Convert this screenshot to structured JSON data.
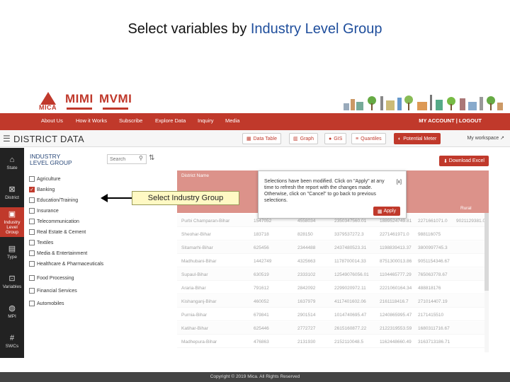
{
  "slide": {
    "title_prefix": "Select variables by ",
    "title_highlight": "Industry Level Group"
  },
  "brand": {
    "logos": [
      "MICA",
      "MIMI",
      "MVMI"
    ],
    "accent": "#c0392b"
  },
  "nav": {
    "items": [
      "About Us",
      "How it Works",
      "Subscribe",
      "Explore Data",
      "Inquiry",
      "Media"
    ],
    "account": "MY ACCOUNT | LOGOUT"
  },
  "header": {
    "title": "DISTRICT DATA",
    "tools": [
      "Data Table",
      "Graph",
      "GIS",
      "Quantiles",
      "Potential Meter"
    ],
    "workspace": "My workspace"
  },
  "rail": [
    {
      "icon": "state-icon",
      "label": "State"
    },
    {
      "icon": "district-icon",
      "label": "District"
    },
    {
      "icon": "industry-icon",
      "label": "Industry Level Group"
    },
    {
      "icon": "type-icon",
      "label": "Type"
    },
    {
      "icon": "variables-icon",
      "label": "Variables"
    },
    {
      "icon": "mpi-icon",
      "label": "MPI"
    },
    {
      "icon": "swcs-icon",
      "label": "SWCs"
    }
  ],
  "panel": {
    "heading_line1": "INDUSTRY",
    "heading_line2": "LEVEL GROUP",
    "search_placeholder": "Search",
    "options": [
      {
        "label": "Agriculture",
        "checked": false
      },
      {
        "label": "Banking",
        "checked": true
      },
      {
        "label": "Education/Training",
        "checked": false
      },
      {
        "label": "Insurance",
        "checked": false
      },
      {
        "label": "Telecommunication",
        "checked": false
      },
      {
        "label": "Real Estate & Cement",
        "checked": false
      },
      {
        "label": "Textiles",
        "checked": false
      },
      {
        "label": "Media & Entertainment",
        "checked": false
      },
      {
        "label": "Healthcare & Pharmaceuticals",
        "checked": false
      },
      {
        "label": "Food Processing",
        "checked": false
      },
      {
        "label": "Financial Services",
        "checked": false
      },
      {
        "label": "Automobiles",
        "checked": false
      }
    ]
  },
  "table": {
    "download_label": "Download Excel",
    "column_header": "District Name",
    "rural_label": "Rural",
    "rows": [
      [
        "Purbi Champaran-Bihar",
        "1547052",
        "4558034",
        "2350347560.01",
        "1889524749.81",
        "2271661071.0",
        "9021129381.00"
      ],
      [
        "Sheohar-Bihar",
        "183718",
        "828150",
        "3379537272.3",
        "2271461971.0",
        "988116075",
        ""
      ],
      [
        "Sitamarhi-Bihar",
        "625456",
        "2344488",
        "2437480523.31",
        "1198839413.37",
        "3800997745.3",
        ""
      ],
      [
        "Madhubani-Bihar",
        "1442749",
        "4325663",
        "1178700014.33",
        "8751300013.86",
        "9051154346.67",
        ""
      ],
      [
        "Supaul-Bihar",
        "630519",
        "2333102",
        "12549076056.01",
        "1104465777.29",
        "765063778.67",
        ""
      ],
      [
        "Araria-Bihar",
        "791612",
        "2842092",
        "2299020972.11",
        "2221060164.34",
        "488818176",
        ""
      ],
      [
        "Kishanganj-Bihar",
        "460052",
        "1637979",
        "4117401602.06",
        "2161118416.7",
        "271014407.19",
        ""
      ],
      [
        "Purnia-Bihar",
        "679841",
        "2901514",
        "1014740695.47",
        "1240865995.47",
        "2171415510",
        ""
      ],
      [
        "Katihar-Bihar",
        "625446",
        "2772727",
        "2615160877.22",
        "2122319553.59",
        "1680311716.67",
        ""
      ],
      [
        "Madhepura-Bihar",
        "476863",
        "2131930",
        "2152110048.5",
        "1162448660.49",
        "3163713186.71",
        ""
      ]
    ]
  },
  "popup": {
    "message": "Selections have been modified. Click on \"Apply\" at any time to refresh the report with the changes made. Otherwise, click on \"Cancel\" to go back to previous selections.",
    "close_label": "[x]",
    "apply_label": "Apply"
  },
  "callout": {
    "text": "Select Industry Group"
  },
  "footer": {
    "text": "Copyright © 2019 Mica. All Rights Reserved"
  }
}
